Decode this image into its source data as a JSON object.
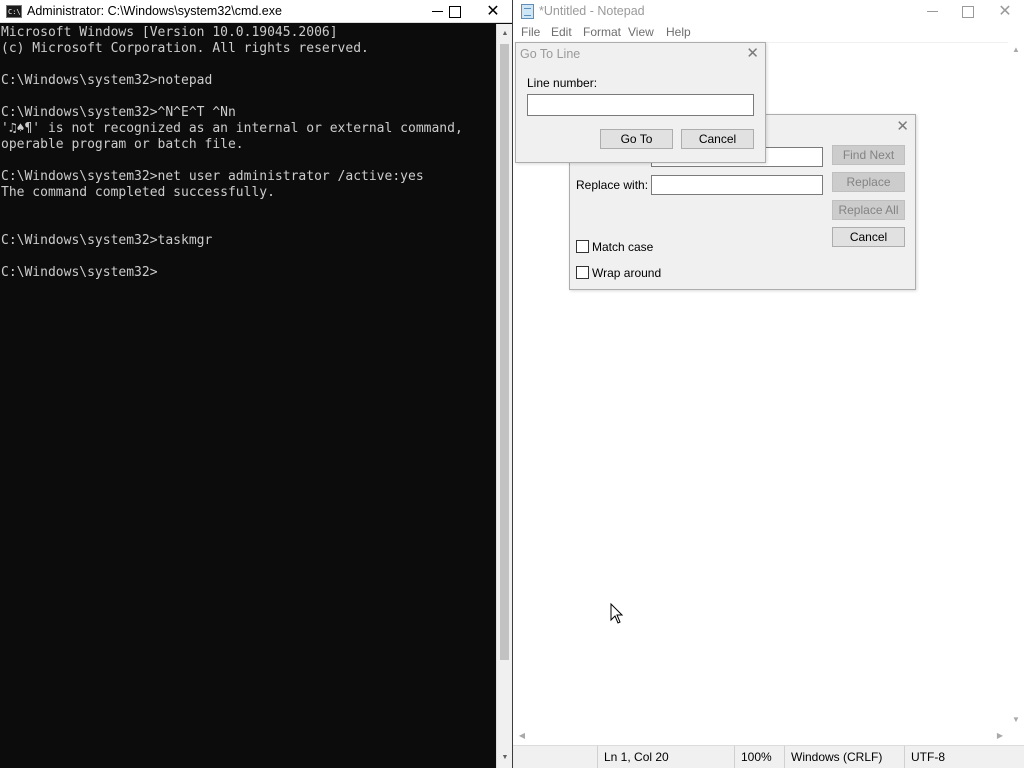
{
  "cmd": {
    "title": "Administrator: C:\\Windows\\system32\\cmd.exe",
    "icon_label": "C:\\",
    "controls": {
      "minimize": "",
      "maximize": "",
      "close": "✕"
    },
    "lines": [
      "Microsoft Windows [Version 10.0.19045.2006]",
      "(c) Microsoft Corporation. All rights reserved.",
      "",
      "C:\\Windows\\system32>notepad",
      "",
      "C:\\Windows\\system32>^N^E^T ^Nn",
      "'♫♠¶' is not recognized as an internal or external command,",
      "operable program or batch file.",
      "",
      "C:\\Windows\\system32>net user administrator /active:yes",
      "The command completed successfully.",
      "",
      "",
      "C:\\Windows\\system32>taskmgr",
      "",
      "C:\\Windows\\system32>"
    ],
    "scroll_up": "▲",
    "scroll_down": "▼"
  },
  "notepad": {
    "title": "*Untitled - Notepad",
    "controls": {
      "minimize": "",
      "maximize": "",
      "close": "✕"
    },
    "menu": {
      "file": "File",
      "edit": "Edit",
      "format": "Format",
      "view": "View",
      "help": "Help"
    },
    "scroll": {
      "up": "▲",
      "down": "▼",
      "left": "◀",
      "right": "▶"
    },
    "status": {
      "position": "Ln 1, Col 20",
      "zoom": "100%",
      "line_ending": "Windows (CRLF)",
      "encoding": "UTF-8"
    }
  },
  "replace_dialog": {
    "close": "✕",
    "replace_with_label": "Replace with:",
    "find_value": "",
    "replace_value": "",
    "find_next": "Find Next",
    "replace": "Replace",
    "replace_all": "Replace All",
    "cancel": "Cancel",
    "match_case": "Match case",
    "wrap_around": "Wrap around"
  },
  "goto_dialog": {
    "title": "Go To Line",
    "close": "✕",
    "line_number_label": "Line number:",
    "line_number_value": "",
    "go_to": "Go To",
    "cancel": "Cancel"
  }
}
